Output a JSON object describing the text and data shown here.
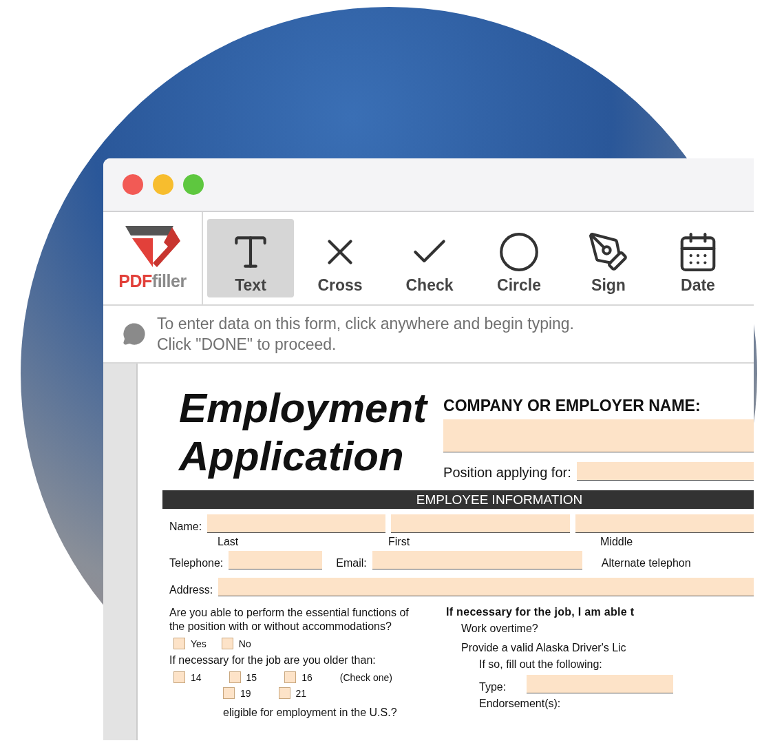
{
  "toolbar": {
    "logo": {
      "brand_a": "PDF",
      "brand_b": "filler"
    },
    "tools": [
      {
        "kind": "text",
        "label": "Text",
        "selected": true
      },
      {
        "kind": "cross",
        "label": "Cross",
        "selected": false
      },
      {
        "kind": "check",
        "label": "Check",
        "selected": false
      },
      {
        "kind": "circle",
        "label": "Circle",
        "selected": false
      },
      {
        "kind": "sign",
        "label": "Sign",
        "selected": false
      },
      {
        "kind": "date",
        "label": "Date",
        "selected": false
      }
    ]
  },
  "hint": {
    "lines": [
      "To enter data on this form, click anywhere and begin typing.",
      "Click \"DONE\" to proceed."
    ]
  },
  "form": {
    "title_lines": [
      "Employment",
      "Application"
    ],
    "company_label": "COMPANY OR EMPLOYER NAME:",
    "position_label": "Position applying for:",
    "section": "EMPLOYEE INFORMATION",
    "name_label": "Name:",
    "name_parts": [
      "Last",
      "First",
      "Middle"
    ],
    "telephone_label": "Telephone:",
    "email_label": "Email:",
    "alternate_label": "Alternate telephon",
    "address_label": "Address:",
    "left": {
      "question_1": "Are you able to perform the essential functions of the position with or without accommodations?",
      "answers_1": [
        {
          "label": "Yes",
          "checked": false
        },
        {
          "label": "No",
          "checked": false
        }
      ],
      "question_2": "If necessary for the job are you older than:",
      "ages_row_1": [
        {
          "label": "14",
          "checked": false
        },
        {
          "label": "15",
          "checked": false
        },
        {
          "label": "16",
          "checked": false
        }
      ],
      "check_one": "(Check one)",
      "ages_row_2": [
        {
          "label": "19",
          "checked": false
        },
        {
          "label": "21",
          "checked": false
        }
      ],
      "question_3": "eligible for employment in the U.S.?"
    },
    "right": {
      "heading": "If necessary for the job, I am able t",
      "work_overtime": "Work overtime?",
      "license": "Provide a valid Alaska Driver's Lic",
      "if_so": "If so, fill out the following:",
      "type_label": "Type:",
      "endorsement_label": "Endorsement(s):"
    }
  }
}
